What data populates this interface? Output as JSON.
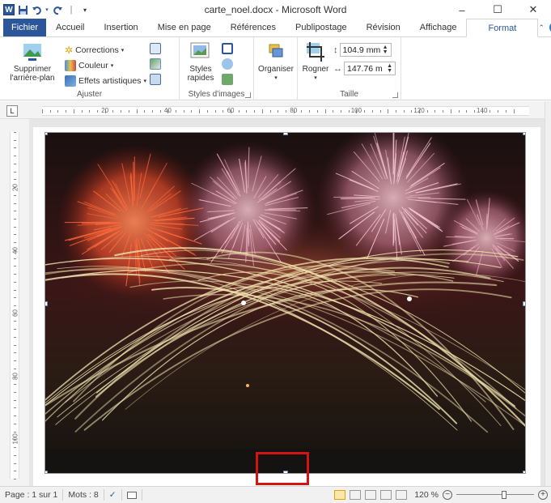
{
  "window": {
    "title": "carte_noel.docx - Microsoft Word",
    "minimize": "–",
    "maximize": "☐",
    "close": "✕"
  },
  "qat": {
    "logo": "W",
    "save_icon": "save-icon",
    "undo_icon": "undo-icon",
    "redo_icon": "redo-icon",
    "separator": "|"
  },
  "tabs": [
    {
      "label": "Fichier"
    },
    {
      "label": "Accueil"
    },
    {
      "label": "Insertion"
    },
    {
      "label": "Mise en page"
    },
    {
      "label": "Références"
    },
    {
      "label": "Publipostage"
    },
    {
      "label": "Révision"
    },
    {
      "label": "Affichage"
    },
    {
      "label": "Format"
    }
  ],
  "ribbon": {
    "ajuster": {
      "remove_bg": "Supprimer l'arrière-plan",
      "remove_bg_line1": "Supprimer",
      "remove_bg_line2": "l'arrière-plan",
      "corrections": "Corrections",
      "couleur": "Couleur",
      "effets": "Effets artistiques",
      "label": "Ajuster"
    },
    "styles": {
      "rapides_line1": "Styles",
      "rapides_line2": "rapides",
      "label": "Styles d'images"
    },
    "organiser": {
      "label": "Organiser"
    },
    "taille": {
      "rogner": "Rogner",
      "height": "104.9 mm",
      "width": "147.76 m",
      "label": "Taille"
    }
  },
  "ruler": {
    "h_numbers": [
      "20",
      "40",
      "60",
      "80",
      "100",
      "120",
      "140"
    ],
    "v_numbers": [
      "20",
      "40",
      "60",
      "80",
      "100"
    ]
  },
  "status": {
    "page": "Page : 1 sur 1",
    "words": "Mots : 8",
    "zoom": "120 %",
    "zoom_level": 0.62
  },
  "colors": {
    "accent": "#2b579a",
    "highlight": "#d41414"
  }
}
